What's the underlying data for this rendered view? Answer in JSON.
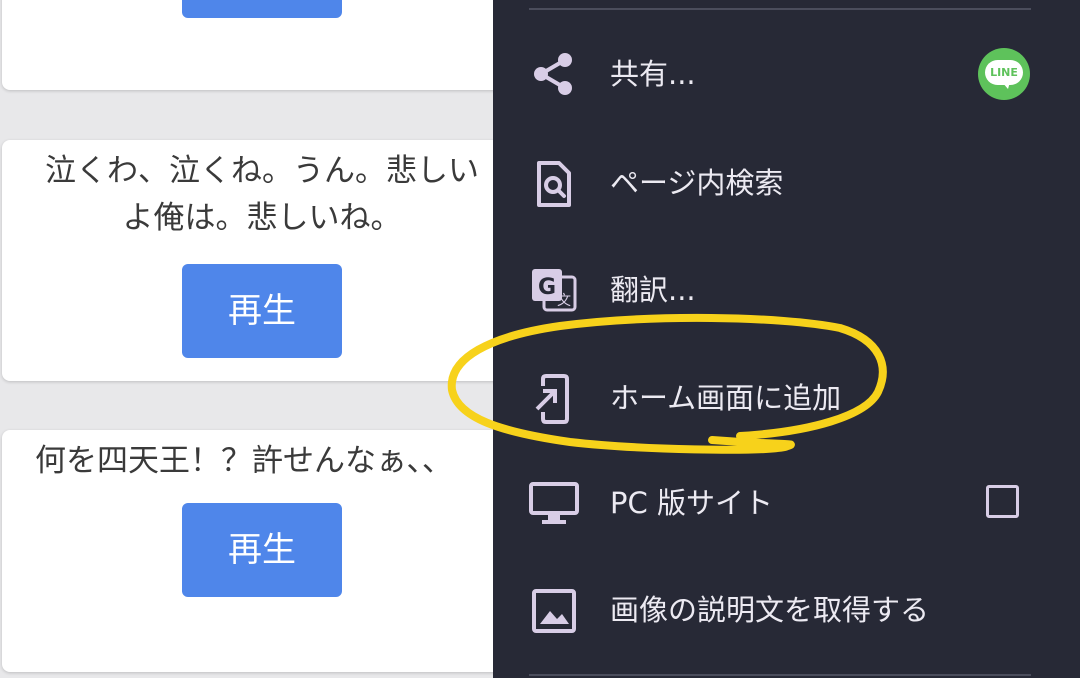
{
  "cards": [
    {
      "text_lines": [],
      "play_label": ""
    },
    {
      "text_lines": [
        "泣くわ、泣くね。うん。悲しい",
        "よ俺は。悲しいね。"
      ],
      "play_label": "再生"
    },
    {
      "text_lines": [
        "何を四天王！？許せんなぁ、、"
      ],
      "play_label": "再生"
    }
  ],
  "menu": {
    "items": [
      {
        "label": "共有...",
        "icon": "share-icon",
        "trailing": "line-app-icon"
      },
      {
        "label": "ページ内検索",
        "icon": "find-in-page-icon"
      },
      {
        "label": "翻訳...",
        "icon": "translate-icon"
      },
      {
        "label": "ホーム画面に追加",
        "icon": "add-to-home-screen-icon"
      },
      {
        "label": "PC 版サイト",
        "icon": "desktop-icon",
        "trailing": "checkbox",
        "checked": false
      },
      {
        "label": "画像の説明文を取得する",
        "icon": "image-icon"
      }
    ],
    "line_badge_text": "LINE"
  },
  "colors": {
    "menu_background": "#272936",
    "menu_icon": "#d8cde6",
    "play_button": "#4f86ea",
    "highlight": "#f7d21b",
    "line_green": "#5ec25b"
  }
}
